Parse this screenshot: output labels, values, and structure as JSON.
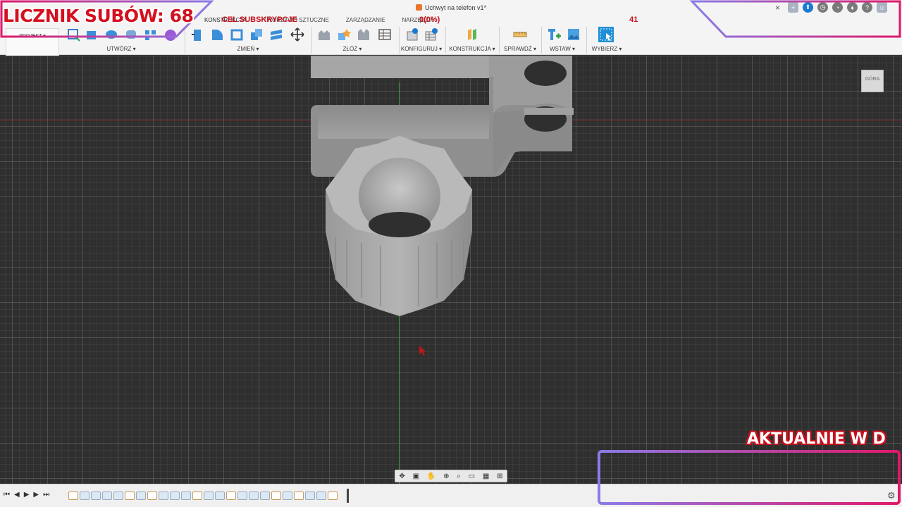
{
  "window": {
    "doc_title": "Uchwyt na telefon v1*",
    "close_glyph": "×"
  },
  "toolbar": {
    "projekt_label": "PROJEKT ▾",
    "tabs": [
      "KONSTRUKCJA",
      "TWORZYWO SZTUCZNE",
      "ZARZĄDZANIE",
      "NARZĘDZIA"
    ],
    "groups": {
      "create": "UTWÓRZ ▾",
      "modify": "ZMIEŃ ▾",
      "assemble": "ZŁÓŻ ▾",
      "configure": "KONFIGURUJ ▾",
      "construct": "KONSTRUKCJA ▾",
      "inspect": "SPRAWDŹ ▾",
      "insert": "WSTAW ▾",
      "select": "WYBIERZ ▾"
    }
  },
  "viewcube": {
    "label": "GÓRA"
  },
  "overlay": {
    "sub_counter": "LICZNIK SUBÓW: 68",
    "goal_label": "CEL SUBSKRYPCJE",
    "progress": "0(0%)",
    "goal_value": "41",
    "now_label": "AKTUALNIE W D"
  },
  "colors": {
    "accent_red": "#d4101f",
    "frame_pink": "#e0186a",
    "frame_purple": "#8b7be8"
  }
}
